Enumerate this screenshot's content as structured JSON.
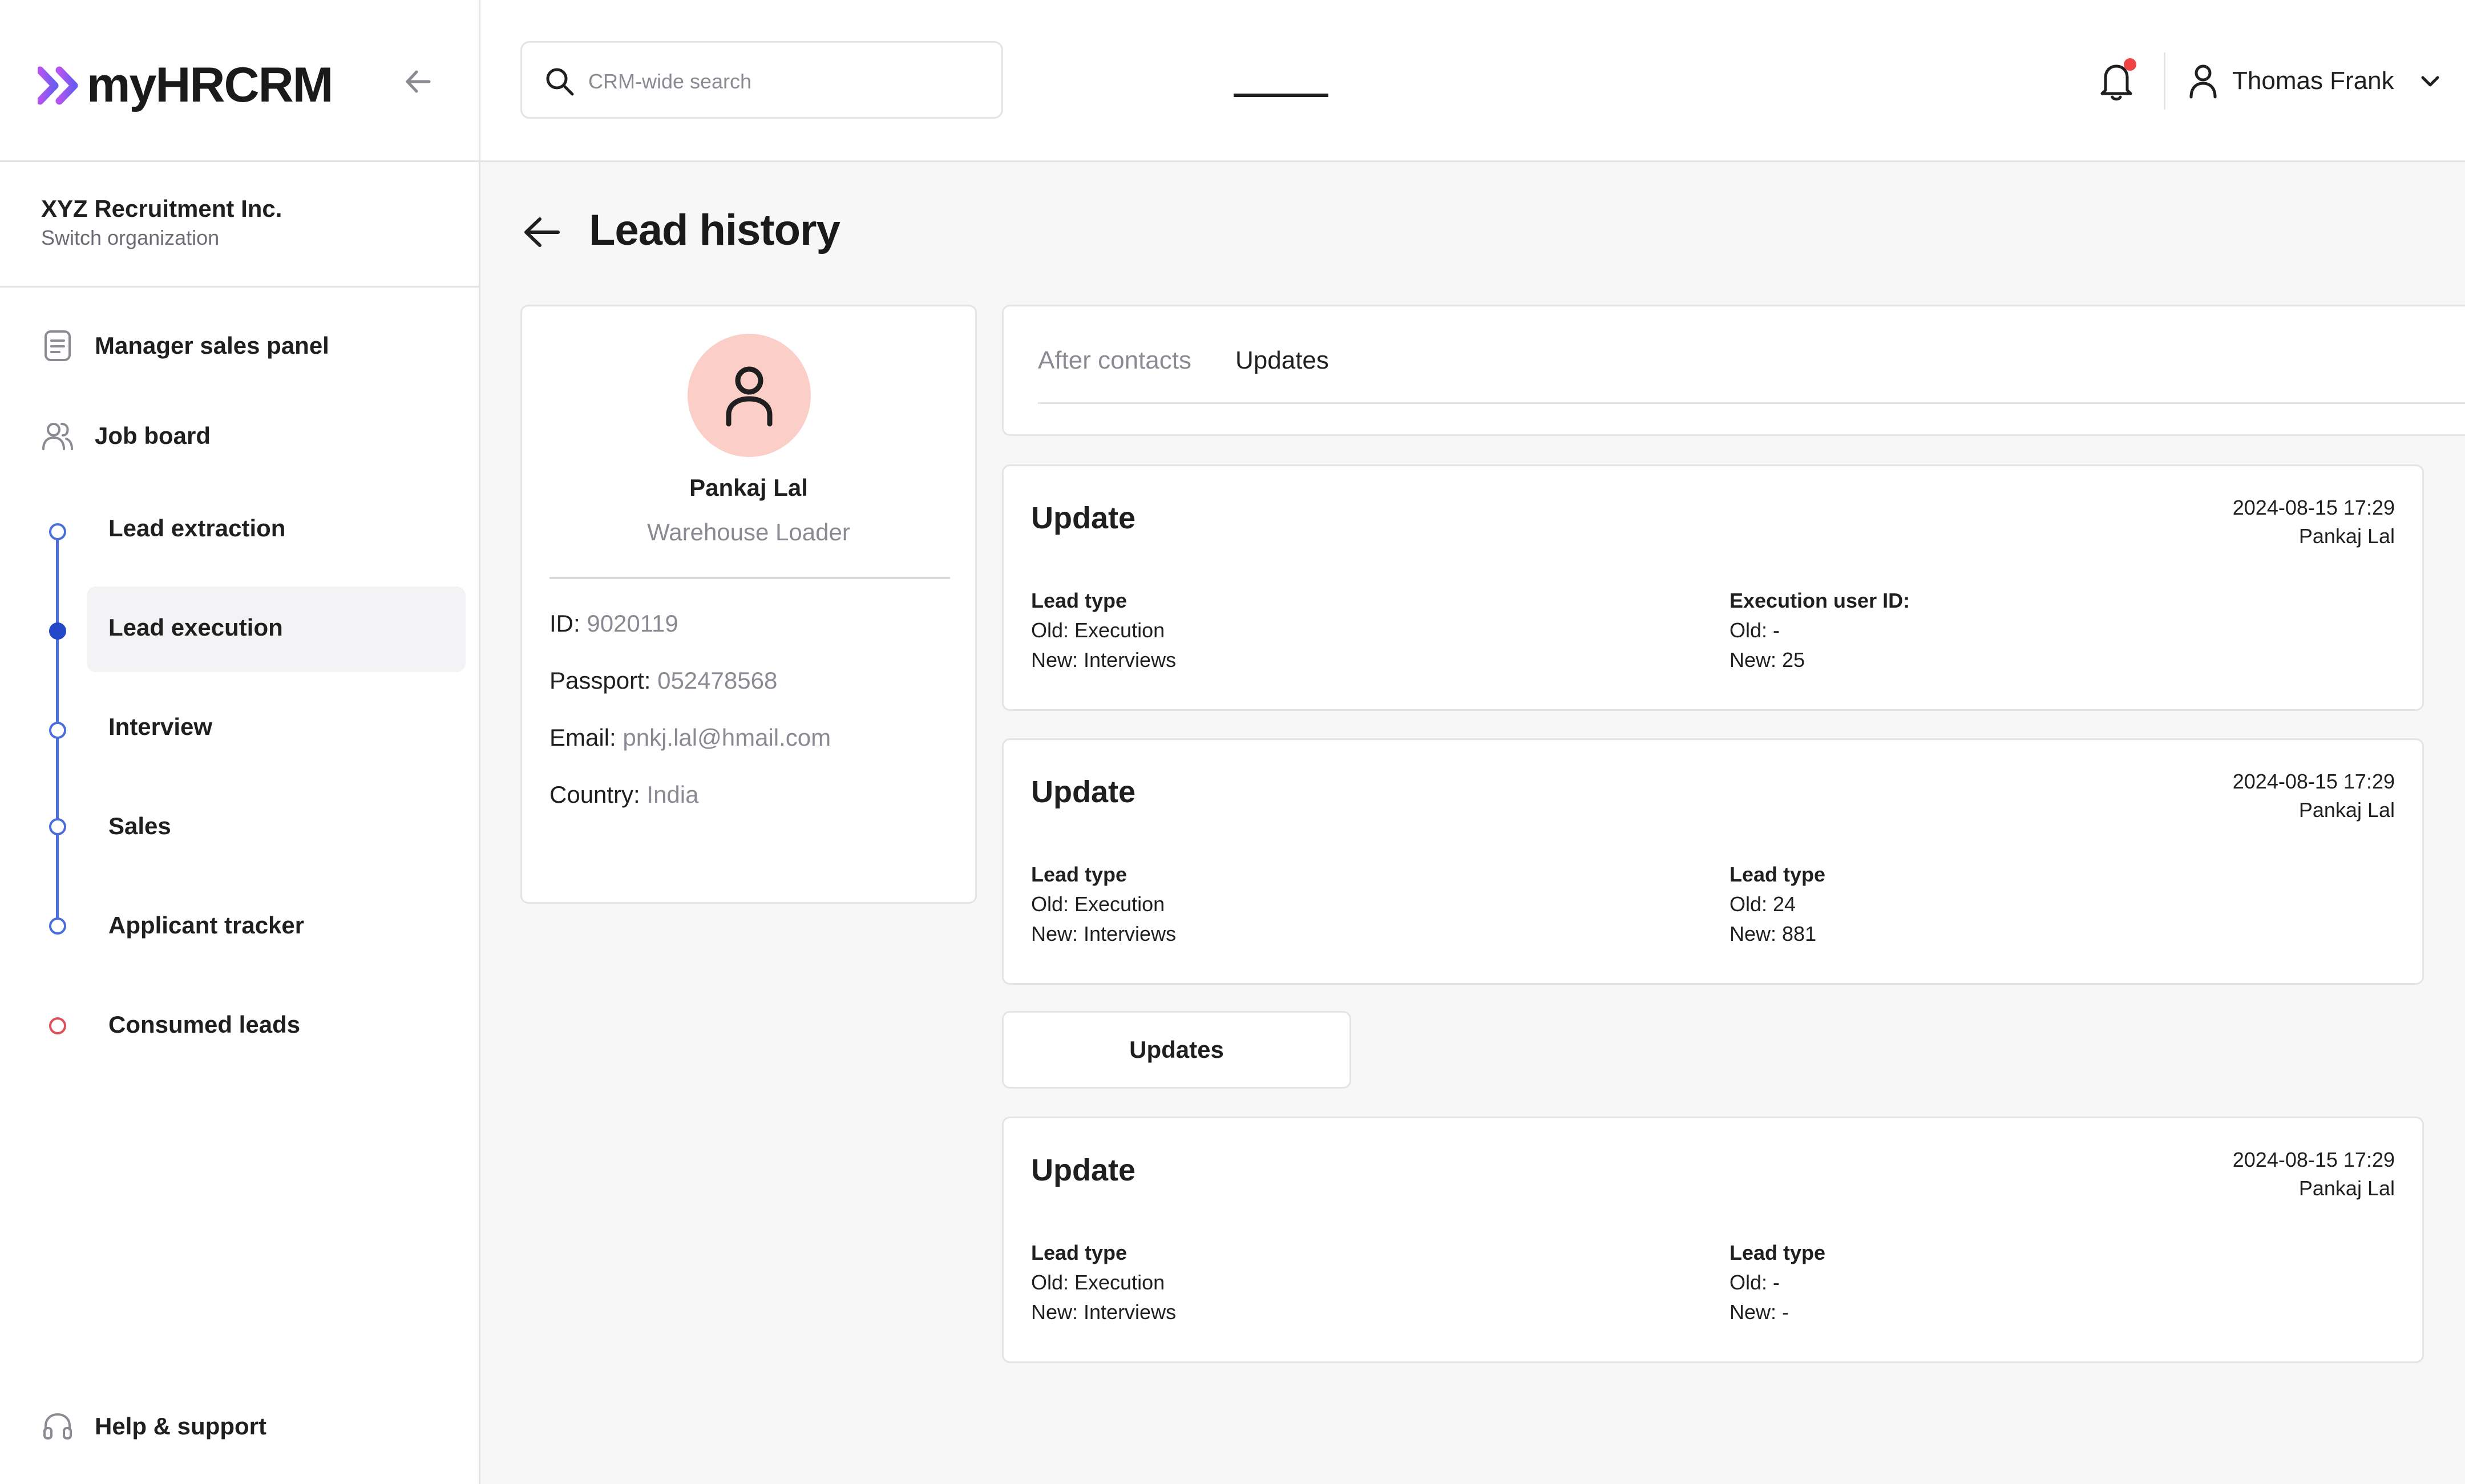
{
  "brand": {
    "logo_text": "myHRCRM"
  },
  "organization": {
    "name": "XYZ Recruitment Inc.",
    "switch_label": "Switch organization"
  },
  "sidebar": {
    "items": [
      {
        "label": "Manager sales panel",
        "icon": "document-list-icon"
      },
      {
        "label": "Job board",
        "icon": "users-icon"
      }
    ],
    "stages": [
      {
        "label": "Lead extraction",
        "active": false
      },
      {
        "label": "Lead execution",
        "active": true
      },
      {
        "label": "Interview",
        "active": false
      },
      {
        "label": "Sales",
        "active": false
      },
      {
        "label": "Applicant tracker",
        "active": false
      }
    ],
    "consumed": {
      "label": "Consumed leads"
    },
    "help": {
      "label": "Help & support",
      "icon": "headset-icon"
    }
  },
  "header": {
    "search": {
      "placeholder": "CRM-wide search",
      "value": ""
    },
    "user": {
      "name": "Thomas Frank"
    },
    "notifications": {
      "has_unread": true
    }
  },
  "page": {
    "title": "Lead history"
  },
  "profile": {
    "name": "Pankaj Lal",
    "role": "Warehouse Loader",
    "fields": [
      {
        "label": "ID:",
        "value": "9020119"
      },
      {
        "label": "Passport:",
        "value": "052478568"
      },
      {
        "label": "Email:",
        "value": "pnkj.lal@hmail.com"
      },
      {
        "label": "Country:",
        "value": "India"
      }
    ]
  },
  "tabs": [
    {
      "label": "After contacts",
      "active": false
    },
    {
      "label": "Updates",
      "active": true
    }
  ],
  "updates": [
    {
      "title": "Update",
      "date": "2024-08-15 17:29",
      "author": "Pankaj Lal",
      "left": {
        "heading": "Lead type",
        "old": "Old: Execution",
        "new": "New: Interviews"
      },
      "right": {
        "heading": "Execution user ID:",
        "old": "Old: -",
        "new": "New: 25"
      }
    },
    {
      "title": "Update",
      "date": "2024-08-15 17:29",
      "author": "Pankaj Lal",
      "left": {
        "heading": "Lead type",
        "old": "Old: Execution",
        "new": "New: Interviews"
      },
      "right": {
        "heading": "Lead type",
        "old": "Old: 24",
        "new": "New: 881"
      }
    },
    {
      "title": "Update",
      "date": "2024-08-15 17:29",
      "author": "Pankaj Lal",
      "left": {
        "heading": "Lead type",
        "old": "Old: Execution",
        "new": "New: Interviews"
      },
      "right": {
        "heading": "Lead type",
        "old": "Old: -",
        "new": "New: -"
      }
    }
  ],
  "updates_button": {
    "label": "Updates"
  },
  "colors": {
    "accent": "#2448c7",
    "stage_line": "#4a6fdc",
    "avatar_bg": "#fbcfc8",
    "notification_dot": "#ef4444",
    "logo_gradient_start": "#a855f7",
    "logo_gradient_end": "#6366f1"
  }
}
